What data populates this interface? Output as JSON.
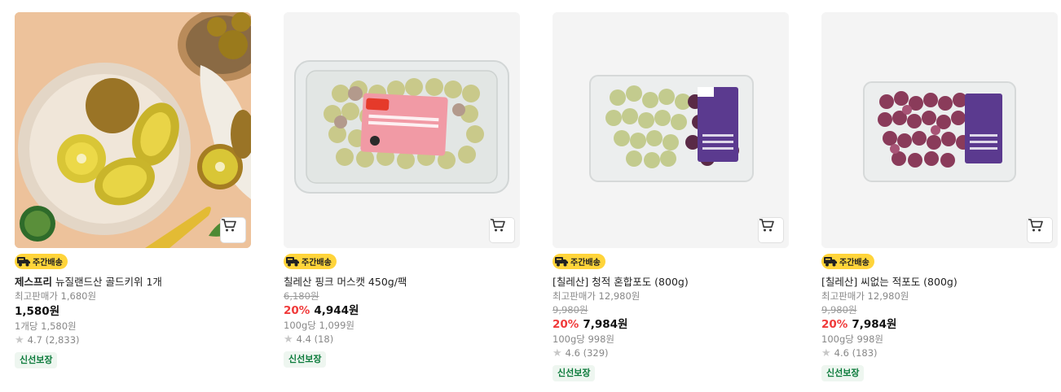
{
  "products": [
    {
      "badge": "주간배송",
      "brand": "제스프리",
      "name": "뉴질랜드산 골드키위 1개",
      "best_price_label": "최고판매가 1,680원",
      "price": "1,580원",
      "unit_price": "1개당 1,580원",
      "rating": "4.7 (2,833)",
      "tag": "신선보장"
    },
    {
      "badge": "주간배송",
      "name": "칠레산 핑크 머스캣 450g/팩",
      "original_price": "6,180원",
      "discount": "20%",
      "price": "4,944원",
      "unit_price": "100g당 1,099원",
      "rating": "4.4 (18)",
      "tag": "신선보장"
    },
    {
      "badge": "주간배송",
      "name": "[칠레산] 청적 혼합포도 (800g)",
      "best_price_label": "최고판매가 12,980원",
      "original_price": "9,980원",
      "discount": "20%",
      "price": "7,984원",
      "unit_price": "100g당 998원",
      "rating": "4.6 (329)",
      "tag": "신선보장"
    },
    {
      "badge": "주간배송",
      "name": "[칠레산] 씨없는 적포도 (800g)",
      "best_price_label": "최고판매가 12,980원",
      "original_price": "9,980원",
      "discount": "20%",
      "price": "7,984원",
      "unit_price": "100g당 998원",
      "rating": "4.6 (183)",
      "tag": "신선보장"
    }
  ],
  "colors": {
    "badge_bg": "#ffd43a",
    "discount": "#f03a3a",
    "fresh_text": "#0a7a3a",
    "fresh_bg": "#eef6f0"
  },
  "icons": [
    "cart-icon",
    "truck-icon",
    "star-icon"
  ]
}
